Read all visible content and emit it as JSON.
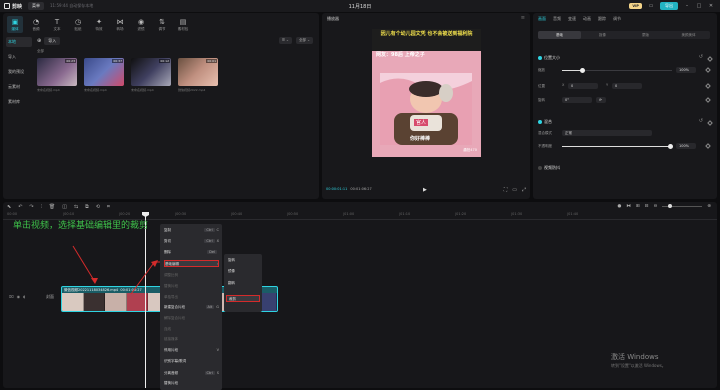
{
  "app": {
    "name": "剪映",
    "menu_label": "菜单",
    "autosave": "11:59:44 自动保存本地",
    "title": "11月18日",
    "vip": "VIP",
    "export_label": "导出"
  },
  "media": {
    "tools": [
      {
        "icon": "media-icon",
        "glyph": "▣",
        "label": "媒体"
      },
      {
        "icon": "audio-icon",
        "glyph": "◔",
        "label": "音频"
      },
      {
        "icon": "text-icon",
        "glyph": "T",
        "label": "文本"
      },
      {
        "icon": "sticker-icon",
        "glyph": "◷",
        "label": "贴纸"
      },
      {
        "icon": "effects-icon",
        "glyph": "✦",
        "label": "特效"
      },
      {
        "icon": "transition-icon",
        "glyph": "⋈",
        "label": "转场"
      },
      {
        "icon": "filter-icon",
        "glyph": "◉",
        "label": "滤镜"
      },
      {
        "icon": "adjust-icon",
        "glyph": "⇅",
        "label": "调节"
      },
      {
        "icon": "template-icon",
        "glyph": "▤",
        "label": "素材包"
      }
    ],
    "side": [
      "本地",
      "导入",
      "我的预设",
      "云素材",
      "素材库"
    ],
    "import_label": "导入",
    "sub_label": "全部",
    "view_controls": [
      "☰ ⌄",
      "全部 ⌄"
    ],
    "thumbs": [
      {
        "duration": "00:23",
        "name": "未命名视频.mp4"
      },
      {
        "duration": "00:37",
        "name": "未命名视频.mp4"
      },
      {
        "duration": "00:12",
        "name": "未命名视频.mp4"
      },
      {
        "duration": "00:01",
        "name": "微信视频2022.mp4"
      }
    ]
  },
  "player": {
    "title": "播放器",
    "caption": "因儿有个幼儿园文凭 也不会被送到福利院",
    "netizen": "网友：98后 上帝之子",
    "sticker1": "官人",
    "sticker2": "你好棒棒",
    "logo": "趣拍470",
    "current_time": "00:00:01:11",
    "total_time": "00:01:06:27"
  },
  "props": {
    "tabs": [
      "画面",
      "音频",
      "变速",
      "动画",
      "跟踪",
      "调节"
    ],
    "subtabs": [
      "基础",
      "抠像",
      "蒙版",
      "美颜美体"
    ],
    "position_size": "位置大小",
    "scale_label": "缩放",
    "scale_value": "100%",
    "position_label": "位置",
    "pos_x_label": "X",
    "pos_x": "0",
    "pos_y_label": "Y",
    "pos_y": "0",
    "rotate_label": "旋转",
    "rotate_value": "0°",
    "blend": "混合",
    "blend_mode_label": "混合模式",
    "blend_mode": "正常",
    "opacity_label": "不透明度",
    "opacity_value": "100%",
    "stabilize": "视频防抖"
  },
  "timeline": {
    "ticks": [
      "00:00",
      "|00:10",
      "|00:20",
      "|00:30",
      "|00:40",
      "|00:50",
      "|01:00",
      "|01:10",
      "|01:20",
      "|01:30",
      "|01:40"
    ],
    "cover": "封面",
    "clip_name": "微信视频20221118034826.mp4",
    "clip_duration": "00:01:06:27"
  },
  "annotation": "单击视频，选择基础编辑里的裁剪",
  "context_menu": [
    {
      "label": "复制",
      "key": "Ctrl",
      "letter": "C",
      "dim": false
    },
    {
      "label": "剪切",
      "key": "Ctrl",
      "letter": "X",
      "dim": false
    },
    {
      "label": "删除",
      "key": "Del",
      "letter": "",
      "dim": false
    },
    {
      "label": "基础编辑",
      "key": "",
      "letter": "›",
      "dim": false,
      "hl": true
    },
    {
      "label": "调整比例",
      "key": "",
      "letter": "",
      "dim": true
    },
    {
      "label": "替换片段",
      "key": "",
      "letter": "",
      "dim": true
    },
    {
      "label": "单独导出",
      "key": "",
      "letter": "",
      "dim": true
    },
    {
      "label": "新建复合片段",
      "key": "Alt",
      "letter": "G",
      "dim": false
    },
    {
      "label": "解除复合片段",
      "key": "",
      "letter": "",
      "dim": true
    },
    {
      "label": "连线",
      "key": "",
      "letter": "",
      "dim": true
    },
    {
      "label": "链接媒体",
      "key": "",
      "letter": "",
      "dim": true
    },
    {
      "label": "停用片段",
      "key": "",
      "letter": "V",
      "dim": false
    },
    {
      "label": "识别字幕/歌词",
      "key": "",
      "letter": "",
      "dim": false
    },
    {
      "label": "分离音频",
      "key": "Ctrl",
      "letter": "S",
      "dim": false
    },
    {
      "label": "替换片段",
      "key": "",
      "letter": "",
      "dim": false
    },
    {
      "label": "复制片段",
      "key": "",
      "letter": "",
      "dim": false
    },
    {
      "label": "时间区域",
      "key": "",
      "letter": "›",
      "dim": false
    }
  ],
  "submenu": [
    "旋转",
    "镜像",
    "翻转",
    "裁剪"
  ],
  "windows": {
    "line1": "激活 Windows",
    "line2": "转到\"设置\"以激活 Windows。"
  }
}
